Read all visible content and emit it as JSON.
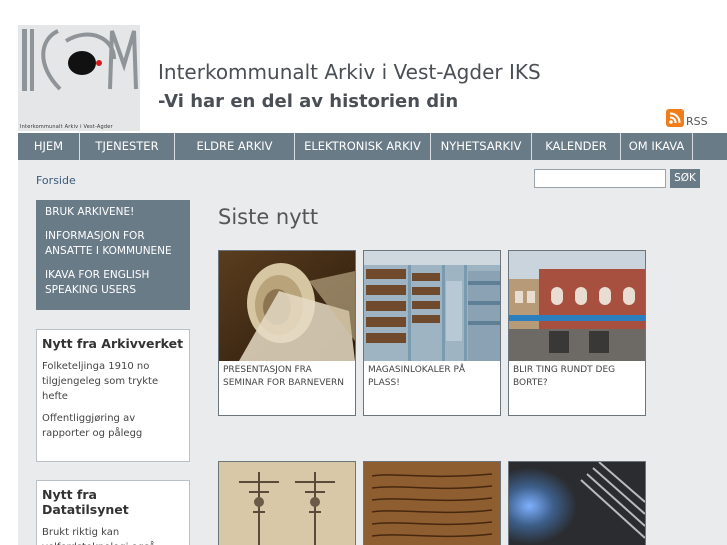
{
  "header": {
    "logo_caption": "Interkommunalt Arkiv i Vest-Agder",
    "title": "Interkommunalt Arkiv i Vest-Agder IKS",
    "slogan": "-Vi har en del av historien din",
    "rss_label": "RSS"
  },
  "nav": {
    "items": [
      {
        "label": "HJEM"
      },
      {
        "label": "TJENESTER"
      },
      {
        "label": "ELDRE ARKIV"
      },
      {
        "label": "ELEKTRONISK ARKIV"
      },
      {
        "label": "NYHETSARKIV"
      },
      {
        "label": "KALENDER"
      },
      {
        "label": "OM IKAVA"
      }
    ]
  },
  "breadcrumb": "Forside",
  "search": {
    "value": "",
    "button_label": "SØK"
  },
  "side_menu": {
    "items": [
      {
        "label": "BRUK ARKIVENE!"
      },
      {
        "label": "INFORMASJON FOR ANSATTE I KOMMUNENE"
      },
      {
        "label": "IKAVA FOR ENGLISH SPEAKING USERS"
      }
    ]
  },
  "box_arkivverket": {
    "title": "Nytt fra Arkivverket",
    "links": [
      {
        "label": "Folketeljinga 1910 no tilgjengeleg som trykte hefte"
      },
      {
        "label": "Offentliggjøring av rapporter og pålegg"
      }
    ]
  },
  "box_datatilsynet": {
    "title": "Nytt fra Datatilsynet",
    "links": [
      {
        "label": "Brukt riktig kan velferdsteknologi også"
      }
    ]
  },
  "news": {
    "title": "Siste nytt",
    "tiles": [
      {
        "caption": "PRESENTASJON FRA SEMINAR FOR BARNEVERN"
      },
      {
        "caption": "MAGASINLOKALER PÅ PLASS!"
      },
      {
        "caption": "BLIR TING RUNDT DEG BORTE?"
      }
    ]
  },
  "colors": {
    "nav_bg": "#6a7b88",
    "content_bg": "#e9ebed",
    "rss": "#f07d1a"
  }
}
